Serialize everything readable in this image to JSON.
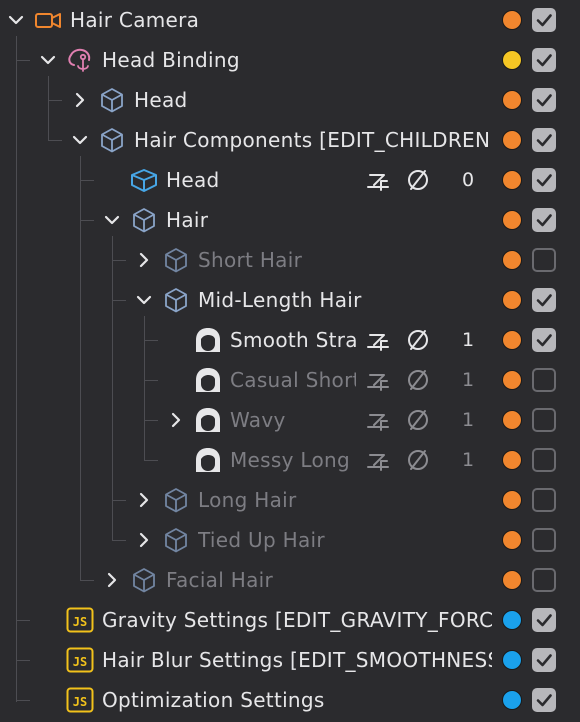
{
  "colors": {
    "orange": "#f0862e",
    "yellow": "#f5c624",
    "blue": "#1aa1ec",
    "label": "#e6e6e8",
    "label_dim": "#7d7d83"
  },
  "rows": [
    {
      "name": "hair-camera-row",
      "label": "Hair Camera",
      "icon": "camera-icon",
      "depth": 0,
      "chevron": "down",
      "dot": "orange",
      "checked": true,
      "dim": false
    },
    {
      "name": "head-binding-row",
      "label": "Head Binding",
      "icon": "anchor-person-icon",
      "depth": 1,
      "chevron": "down",
      "dot": "yellow",
      "checked": true,
      "dim": false
    },
    {
      "name": "head-row",
      "label": "Head",
      "icon": "box-outline-icon",
      "depth": 2,
      "chevron": "right",
      "dot": "orange",
      "checked": true,
      "dim": false
    },
    {
      "name": "hair-components-row",
      "label": "Hair Components [EDIT_CHILDREN]",
      "icon": "box-outline-icon",
      "depth": 2,
      "chevron": "down",
      "dot": "orange",
      "checked": true,
      "dim": false
    },
    {
      "name": "head-mesh-row",
      "label": "Head",
      "icon": "mesh-icon",
      "depth": 3,
      "chevron": "none",
      "dot": "orange",
      "checked": true,
      "dim": false,
      "tools": true,
      "count": "0"
    },
    {
      "name": "hair-row",
      "label": "Hair",
      "icon": "box-outline-icon",
      "depth": 3,
      "chevron": "down",
      "dot": "orange",
      "checked": true,
      "dim": false
    },
    {
      "name": "short-hair-row",
      "label": "Short Hair",
      "icon": "box-outline-icon",
      "depth": 4,
      "chevron": "right",
      "dot": "orange",
      "checked": false,
      "dim": true
    },
    {
      "name": "mid-length-hair-row",
      "label": "Mid-Length Hair",
      "icon": "box-outline-icon",
      "depth": 4,
      "chevron": "down",
      "dot": "orange",
      "checked": true,
      "dim": false
    },
    {
      "name": "smooth-straight-row",
      "label": "Smooth Straight",
      "icon": "hair-face-icon",
      "depth": 5,
      "chevron": "none",
      "dot": "orange",
      "checked": true,
      "dim": false,
      "tools": true,
      "count": "1"
    },
    {
      "name": "casual-short-row",
      "label": "Casual Short",
      "icon": "hair-face-icon",
      "depth": 5,
      "chevron": "none",
      "dot": "orange",
      "checked": false,
      "dim": true,
      "tools": true,
      "count": "1"
    },
    {
      "name": "wavy-row",
      "label": "Wavy",
      "icon": "hair-face-icon",
      "depth": 5,
      "chevron": "right",
      "dot": "orange",
      "checked": false,
      "dim": true,
      "tools": true,
      "count": "1"
    },
    {
      "name": "messy-long-row",
      "label": "Messy Long",
      "icon": "hair-face-icon",
      "depth": 5,
      "chevron": "none",
      "dot": "orange",
      "checked": false,
      "dim": true,
      "tools": true,
      "count": "1"
    },
    {
      "name": "long-hair-row",
      "label": "Long Hair",
      "icon": "box-outline-icon",
      "depth": 4,
      "chevron": "right",
      "dot": "orange",
      "checked": false,
      "dim": true
    },
    {
      "name": "tied-up-hair-row",
      "label": "Tied Up Hair",
      "icon": "box-outline-icon",
      "depth": 4,
      "chevron": "right",
      "dot": "orange",
      "checked": false,
      "dim": true
    },
    {
      "name": "facial-hair-row",
      "label": "Facial Hair",
      "icon": "box-outline-icon",
      "depth": 3,
      "chevron": "right",
      "dot": "orange",
      "checked": false,
      "dim": true
    },
    {
      "name": "gravity-settings-row",
      "label": "Gravity Settings [EDIT_GRAVITY_FORCE]",
      "icon": "js-script-icon",
      "depth": 1,
      "chevron": "none",
      "dot": "blue",
      "checked": true,
      "dim": false
    },
    {
      "name": "hair-blur-settings-row",
      "label": "Hair Blur Settings [EDIT_SMOOTHNESS]",
      "icon": "js-script-icon",
      "depth": 1,
      "chevron": "none",
      "dot": "blue",
      "checked": true,
      "dim": false
    },
    {
      "name": "optimization-settings-row",
      "label": "Optimization Settings",
      "icon": "js-script-icon",
      "depth": 1,
      "chevron": "none",
      "dot": "blue",
      "checked": true,
      "dim": false
    }
  ]
}
